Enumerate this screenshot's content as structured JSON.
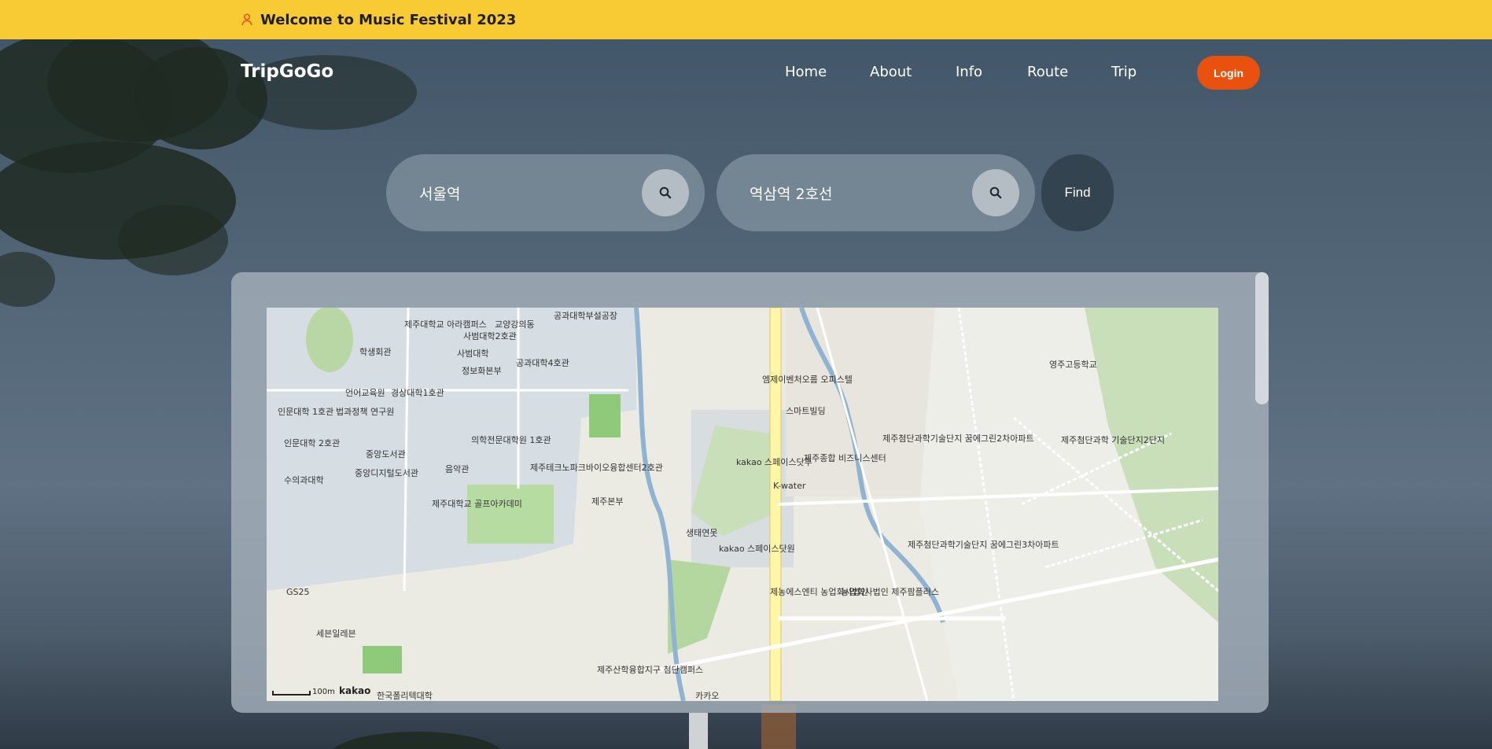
{
  "banner": {
    "icon": "person-icon",
    "title": "Welcome to Music Festival 2023"
  },
  "nav": {
    "brand": "TripGoGo",
    "items": [
      "Home",
      "About",
      "Info",
      "Route",
      "Trip"
    ],
    "login_label": "Login"
  },
  "search": {
    "origin": "서울역",
    "destination": "역삼역 2호선",
    "find_label": "Find",
    "icon": "search-icon"
  },
  "map": {
    "provider": "kakao",
    "scale_label": "100m",
    "labels": [
      "제주대학교 아라캠퍼스",
      "사범대학2호관",
      "교양강의동",
      "공과대학부설공장",
      "학생회관",
      "사범대학",
      "정보화본부",
      "공과대학4호관",
      "언어교육원",
      "경상대학1호관",
      "인문대학 1호관",
      "법과정책 연구원",
      "인문대학 2호관",
      "중앙도서관",
      "의학전문대학원 1호관",
      "수의과대학",
      "중앙디지털도서관",
      "음악관",
      "제주테크노파크바이오융합센터2호관",
      "제주대학교 골프아카데미",
      "제주본부",
      "GS25",
      "세븐일레븐",
      "한국폴리텍대학",
      "엠제이벤처오름 오피스텔",
      "스마트빌딩",
      "kakao 스페이스닷투",
      "제주종합 비즈니스센터",
      "K-water",
      "생태연못",
      "kakao 스페이스닷원",
      "제농에스엔티 농업회사법인",
      "농업회사법인 제주팜플러스",
      "제주첨단과학기술단지 꿈에그린2차아파트",
      "제주첨단과학기술단지 꿈에그린3차아파트",
      "제주첨단과학 기술단지2단지",
      "영주고등학교",
      "제주산학융합지구 첨단캠퍼스",
      "카카오"
    ]
  },
  "colors": {
    "banner": "#f8ca33",
    "login": "#e8520e",
    "find": "#33434f"
  }
}
